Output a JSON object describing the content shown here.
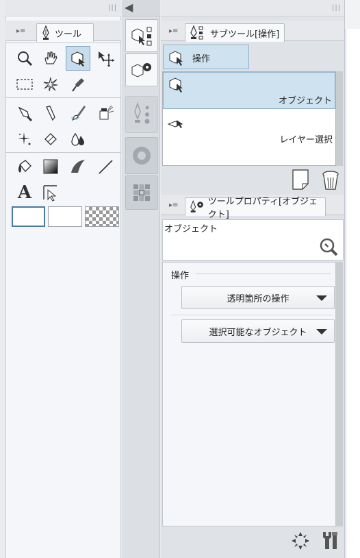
{
  "tool_panel": {
    "tab_label": "ツール",
    "tools_row1": [
      "zoom-icon",
      "hand-icon",
      "object-icon",
      "move-layer-icon"
    ],
    "tools_row2": [
      "selection-marquee-icon",
      "auto-select-icon",
      "eyedropper-icon"
    ],
    "tools_row3": [
      "pen-icon",
      "pencil-icon",
      "brush-icon",
      "airbrush-icon"
    ],
    "tools_row4": [
      "decoration-icon",
      "eraser-icon",
      "blend-icon"
    ],
    "tools_row5": [
      "fill-icon",
      "gradient-icon",
      "frame-border-icon",
      "figure-line-icon"
    ],
    "tools_row6": [
      "text-icon",
      "operation-arrow-icon"
    ],
    "text_glyph": "A"
  },
  "mid_strip": {
    "buttons": [
      "subtool-panel-icon",
      "tool-property-panel-icon",
      "brush-size-icon",
      "color-wheel-icon",
      "color-set-icon"
    ]
  },
  "subtool_panel": {
    "tab_label": "サブツール[操作]",
    "group_button": "操作",
    "items": [
      {
        "label": "オブジェクト",
        "selected": true
      },
      {
        "label": "レイヤー選択",
        "selected": false
      }
    ]
  },
  "property_panel": {
    "tab_label": "ツールプロパティ[オブジェクト]",
    "current_tool": "オブジェクト",
    "section_label": "操作",
    "dropdowns": [
      {
        "label": "透明箇所の操作"
      },
      {
        "label": "選択可能なオブジェクト"
      }
    ]
  },
  "colors": {
    "selected_bg": "#c7dcec",
    "panel_bg": "#f4f6fa"
  }
}
